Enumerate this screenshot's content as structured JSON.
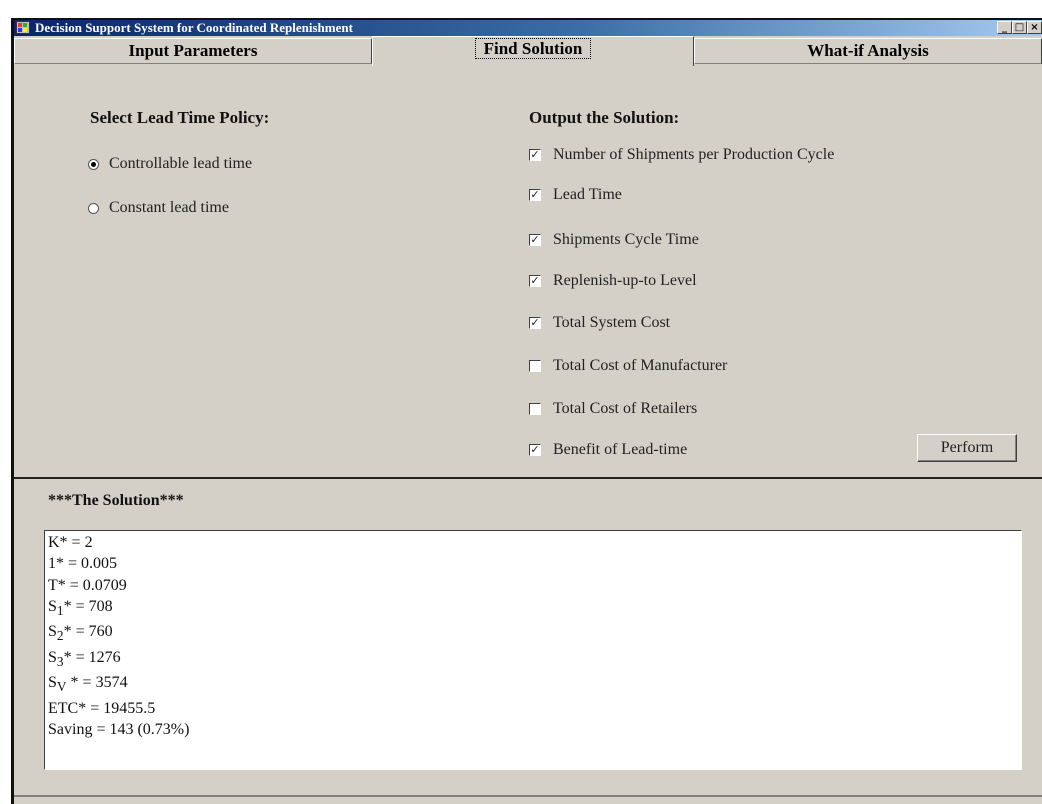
{
  "window": {
    "title": "Decision Support System for Coordinated Replenishment",
    "buttons": [
      "_",
      "□",
      "×"
    ]
  },
  "tabs": [
    {
      "label": "Input Parameters",
      "active": false
    },
    {
      "label": "Find Solution",
      "active": true
    },
    {
      "label": "What-if Analysis",
      "active": false
    }
  ],
  "lead_time": {
    "title": "Select Lead Time Policy:",
    "options": [
      {
        "label": "Controllable lead time",
        "selected": true
      },
      {
        "label": "Constant lead time",
        "selected": false
      }
    ]
  },
  "output": {
    "title": "Output the Solution:",
    "items": [
      {
        "label": "Number of Shipments per Production Cycle",
        "checked": true
      },
      {
        "label": "Lead Time",
        "checked": true
      },
      {
        "label": "Shipments Cycle Time",
        "checked": true
      },
      {
        "label": "Replenish-up-to Level",
        "checked": true
      },
      {
        "label": "Total System Cost",
        "checked": true
      },
      {
        "label": "Total Cost of  Manufacturer",
        "checked": false
      },
      {
        "label": "Total Cost of  Retailers",
        "checked": false
      },
      {
        "label": "Benefit of  Lead-time",
        "checked": true
      }
    ],
    "perform_label": "Perform"
  },
  "solution": {
    "title": "***The Solution***",
    "lines": [
      {
        "main": "K* = 2",
        "sub": "",
        "rest": ""
      },
      {
        "main": "1* = 0.005",
        "sub": "",
        "rest": ""
      },
      {
        "main": "T* = 0.0709",
        "sub": "",
        "rest": ""
      },
      {
        "main": "S",
        "sub": "1",
        "rest": "* =  708"
      },
      {
        "main": "S",
        "sub": "2",
        "rest": "* = 760"
      },
      {
        "main": "S",
        "sub": "3",
        "rest": "* = 1276"
      },
      {
        "main": "S",
        "sub": "V",
        "rest": " * = 3574"
      },
      {
        "main": "ETC* = 19455.5",
        "sub": "",
        "rest": ""
      },
      {
        "main": "Saving = 143 (0.73%)",
        "sub": "",
        "rest": ""
      }
    ]
  }
}
